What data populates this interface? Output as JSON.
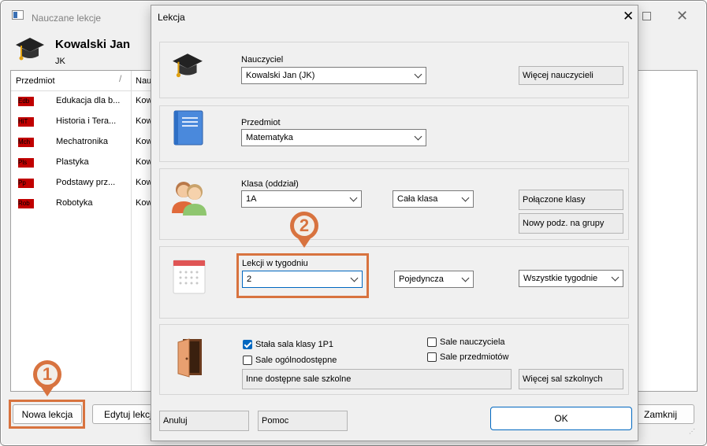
{
  "back_window": {
    "title": "Nauczane lekcje",
    "teacher_name": "Kowalski Jan",
    "teacher_code": "JK",
    "columns": [
      "Przedmiot",
      "Nau"
    ],
    "rows": [
      {
        "badge": "Edb",
        "subject": "Edukacja dla b...",
        "teacher": "Kow"
      },
      {
        "badge": "HiT",
        "subject": "Historia i Tera...",
        "teacher": "Kow"
      },
      {
        "badge": "Mch",
        "subject": "Mechatronika",
        "teacher": "Kow"
      },
      {
        "badge": "Pls",
        "subject": "Plastyka",
        "teacher": "Kow"
      },
      {
        "badge": "Pp",
        "subject": "Podstawy prz...",
        "teacher": "Kow"
      },
      {
        "badge": "Rob",
        "subject": "Robotyka",
        "teacher": "Kow"
      }
    ],
    "buttons": {
      "new_lesson": "Nowa lekcja",
      "edit_lesson": "Edytuj lekcje",
      "close": "Zamknij"
    }
  },
  "dialog": {
    "title": "Lekcja",
    "teacher": {
      "label": "Nauczyciel",
      "value": "Kowalski Jan (JK)",
      "more_button": "Więcej nauczycieli"
    },
    "subject": {
      "label": "Przedmiot",
      "value": "Matematyka"
    },
    "class": {
      "label": "Klasa (oddział)",
      "value": "1A",
      "group": "Cała klasa",
      "joined_button": "Połączone klasy",
      "new_group_button": "Nowy podz. na grupy"
    },
    "lessons": {
      "label": "Lekcji w tygodniu",
      "value": "2",
      "type": "Pojedyncza",
      "weeks": "Wszystkie tygodnie"
    },
    "rooms": {
      "fixed_room": "Stała sala klasy 1P1",
      "common_rooms": "Sale ogólnodostępne",
      "teacher_rooms": "Sale nauczyciela",
      "subject_rooms": "Sale przedmiotów",
      "other_rooms": "Inne dostępne sale szkolne",
      "more_button": "Więcej sal szkolnych",
      "fixed_room_checked": true
    },
    "buttons": {
      "cancel": "Anuluj",
      "help": "Pomoc",
      "ok": "OK"
    }
  },
  "callouts": {
    "one": "1",
    "two": "2"
  },
  "colors": {
    "accent": "#d8733f",
    "badge": "#c00000",
    "check": "#0067c0",
    "ok_border": "#0067c0"
  }
}
